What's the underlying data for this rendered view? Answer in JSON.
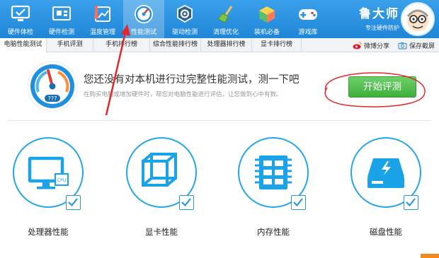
{
  "toolbar": {
    "items": [
      {
        "label": "硬件体检",
        "icon": "monitor-check-icon"
      },
      {
        "label": "硬件检测",
        "icon": "circuit-board-icon"
      },
      {
        "label": "温度管理",
        "icon": "thermometer-icon"
      },
      {
        "label": "性能测试",
        "icon": "speedometer-icon"
      },
      {
        "label": "驱动检测",
        "icon": "driver-gear-icon"
      },
      {
        "label": "清理优化",
        "icon": "broom-icon"
      },
      {
        "label": "装机必备",
        "icon": "software-box-icon"
      },
      {
        "label": "游戏库",
        "icon": "gamepad-icon"
      }
    ],
    "active_index": 3
  },
  "brand": {
    "name": "鲁大师",
    "slogan": "专注硬件防护"
  },
  "tabs": [
    {
      "label": "电脑性能测试"
    },
    {
      "label": "手机评测"
    },
    {
      "label": "手机排行榜"
    },
    {
      "label": "综合性能排行榜"
    },
    {
      "label": "处理器排行榜"
    },
    {
      "label": "显卡排行榜"
    }
  ],
  "tab_actions": {
    "share": "微博分享",
    "screenshot": "保存截屏"
  },
  "banner": {
    "gauge_text": "???",
    "headline": "您还没有对本机进行过完整性能测试，测一下吧",
    "subline": "在购买电脑或增加硬件时，帮您对电脑性能进行评估，让您做到心中有数。",
    "start_button": "开始评测"
  },
  "categories": [
    {
      "label": "处理器性能",
      "icon": "cpu-monitor-icon",
      "chip_text": "CPU"
    },
    {
      "label": "显卡性能",
      "icon": "graphics-cube-icon"
    },
    {
      "label": "内存性能",
      "icon": "memory-chip-icon"
    },
    {
      "label": "磁盘性能",
      "icon": "disk-lightning-icon"
    }
  ],
  "colors": {
    "toolbar": "#1f86d8",
    "accent": "#25a6ea",
    "start_button": "#4cbb48",
    "annotation": "#e3252c"
  }
}
